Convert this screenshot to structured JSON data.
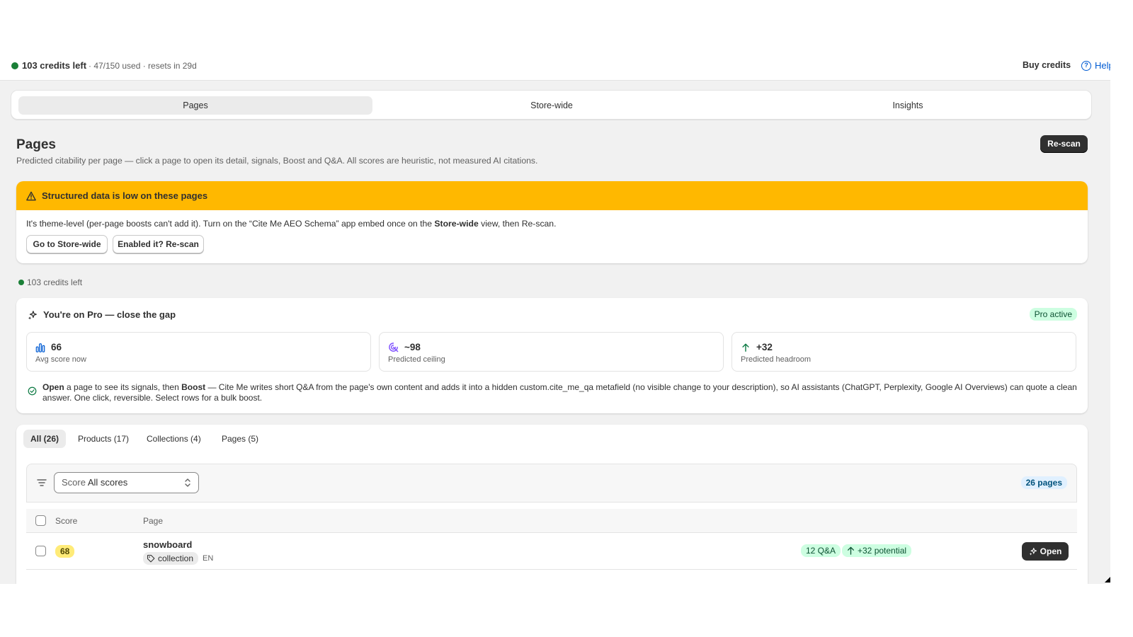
{
  "topbar": {
    "credits": "103 credits left",
    "usage": "· 47/150 used · resets in 29d",
    "buy_credits": "Buy credits",
    "help": "Help"
  },
  "tabs": [
    "Pages",
    "Store-wide",
    "Insights"
  ],
  "header": {
    "title": "Pages",
    "subtitle": "Predicted citability per page — click a page to open its detail, signals, Boost and Q&A. All scores are heuristic, not measured AI citations.",
    "rescan": "Re-scan"
  },
  "banner": {
    "title": "Structured data is low on these pages",
    "text_1": "It's theme-level (per-page boosts can't add it). Turn on the “Cite Me AEO Schema” app embed once on the ",
    "text_bold": "Store-wide",
    "text_2": " view, then Re-scan.",
    "btn_store": "Go to Store-wide",
    "btn_enabled": "Enabled it? Re-scan"
  },
  "credits_small": "103 credits left",
  "pro": {
    "title": "You're on Pro — close the gap",
    "badge": "Pro active",
    "stats": [
      {
        "value": "66",
        "label": "Avg score now",
        "icon": "bar-chart-icon"
      },
      {
        "value": "~98",
        "label": "Predicted ceiling",
        "icon": "target-icon"
      },
      {
        "value": "+32",
        "label": "Predicted headroom",
        "icon": "arrow-up-icon"
      }
    ],
    "note_open": "Open",
    "note_1": " a page to see its signals, then ",
    "note_boost": "Boost",
    "note_2": " — Cite Me writes short Q&A from the page's own content and adds it into a hidden custom.cite_me_qa metafield (no visible change to your description), so AI assistants (ChatGPT, Perplexity, Google AI Overviews) can quote a clean answer. One click, reversible. Select rows for a bulk boost."
  },
  "list": {
    "filters": [
      "All (26)",
      "Products (17)",
      "Collections (4)",
      "Pages (5)"
    ],
    "score_label": "Score",
    "score_value": "All scores",
    "pages_count": "26 pages",
    "columns": {
      "score": "Score",
      "page": "Page"
    },
    "rows": [
      {
        "score": "68",
        "title": "snowboard",
        "type": "collection",
        "lang": "EN",
        "qa": "12 Q&A",
        "potential": "+32 potential",
        "open": "Open"
      }
    ]
  },
  "colors": {
    "accent_dark": "#303030",
    "warning": "#ffb800",
    "success_bg": "#cdfee1",
    "link": "#005bd3",
    "score_bg": "#ffeb78"
  }
}
